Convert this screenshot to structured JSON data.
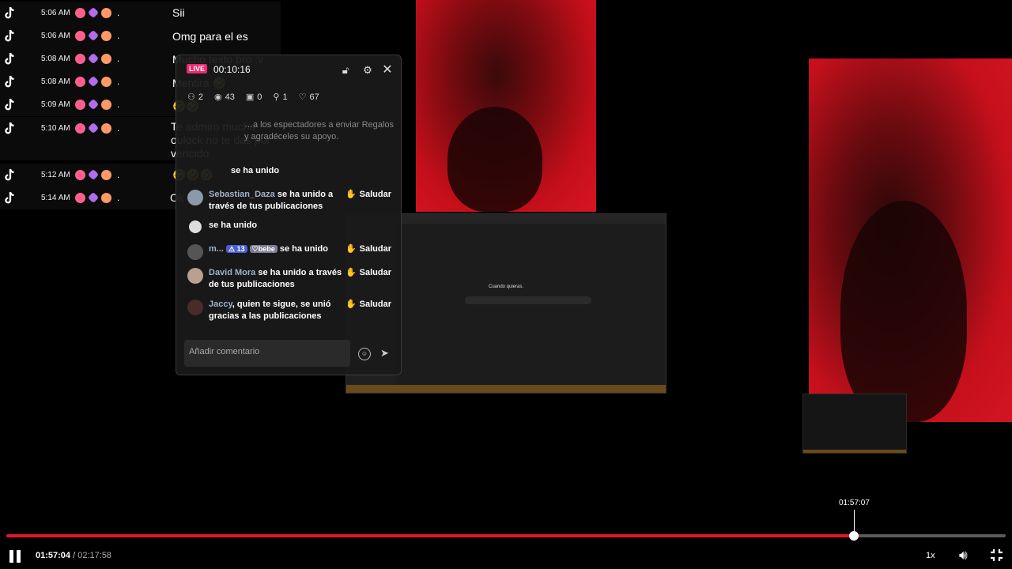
{
  "chat_log": [
    {
      "time": "5:06 AM",
      "message": "Sii"
    },
    {
      "time": "5:06 AM",
      "message": "Omg para el es"
    },
    {
      "time": "5:08 AM",
      "message": "Mucho texto bro :v"
    },
    {
      "time": "5:08 AM",
      "message": "Mentira 🤣"
    },
    {
      "time": "5:09 AM",
      "message": "🤣🤣"
    },
    {
      "time": "5:10 AM",
      "message": "Te admiro mucho oulock no te das por vencido"
    },
    {
      "time": "5:12 AM",
      "message": "🤣🤣🤣"
    },
    {
      "time": "5:14 AM",
      "message": "Ok"
    }
  ],
  "live_panel": {
    "badge": "LIVE",
    "duration": "00:10:16",
    "stats": {
      "participants": "2",
      "viewers": "43",
      "gifts": "0",
      "followers": "1",
      "likes": "67"
    },
    "hint": "…a los espectadores a enviar Regalos y agradéceles su apoyo.",
    "events": [
      {
        "name": "Sebastian_Daza",
        "text": "se ha unido a través de tus publicaciones",
        "action": "Saludar"
      },
      {
        "name": "",
        "text": "se ha unido",
        "action": ""
      },
      {
        "name": "m...",
        "level": "13",
        "fan": "bebe",
        "text": "se ha unido",
        "action": "Saludar"
      },
      {
        "name": "David Mora",
        "text": "se ha unido a través de tus publicaciones",
        "action": "Saludar"
      },
      {
        "name": "Jaccy",
        "text": ", quien te sigue, se unió gracias a las publicaciones",
        "action": "Saludar"
      }
    ],
    "joined_line": "se ha unido",
    "comment_placeholder": "Añadir comentario"
  },
  "screen_share": {
    "caption": "Cuando quieras."
  },
  "player": {
    "hover_time": "01:57:07",
    "current_time": "01:57:04",
    "separator": "/",
    "total_time": "02:17:58",
    "progress_fraction": 0.854,
    "speed": "1x",
    "accent": "#e5162b"
  }
}
